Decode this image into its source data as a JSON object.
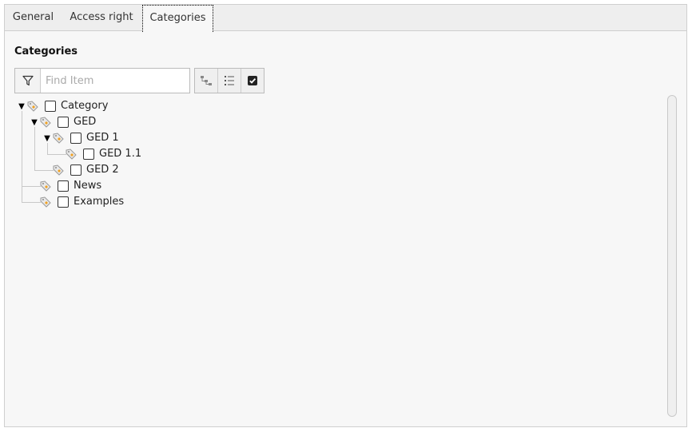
{
  "tabs": [
    {
      "label": "General",
      "active": false
    },
    {
      "label": "Access right",
      "active": false
    },
    {
      "label": "Categories",
      "active": true
    }
  ],
  "panel": {
    "heading": "Categories",
    "search": {
      "placeholder": "Find Item",
      "value": ""
    },
    "toolbar": [
      {
        "name": "expand-tree-icon"
      },
      {
        "name": "list-view-icon"
      },
      {
        "name": "checked-only-icon"
      }
    ]
  },
  "tree": [
    {
      "label": "Category",
      "expanded": true,
      "checked": false
    },
    {
      "label": "GED",
      "expanded": true,
      "checked": false
    },
    {
      "label": "GED 1",
      "expanded": true,
      "checked": false
    },
    {
      "label": "GED 1.1",
      "checked": false
    },
    {
      "label": "GED 2",
      "checked": false
    },
    {
      "label": "News",
      "checked": false
    },
    {
      "label": "Examples",
      "checked": false
    }
  ],
  "colors": {
    "tag_orange": "#f0a020",
    "tag_gray": "#b0b0b0"
  }
}
